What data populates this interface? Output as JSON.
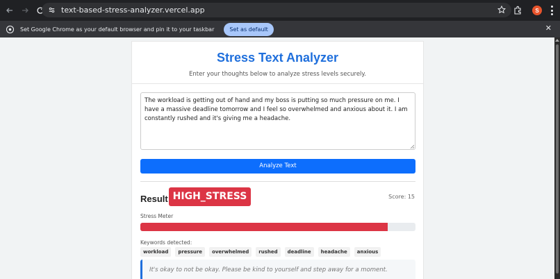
{
  "browser": {
    "url": "text-based-stress-analyzer.vercel.app",
    "avatar_initial": "S"
  },
  "infobar": {
    "message": "Set Google Chrome as your default browser and pin it to your taskbar",
    "button_label": "Set as default",
    "close_glyph": "✕"
  },
  "app": {
    "title": "Stress Text Analyzer",
    "subtitle": "Enter your thoughts below to analyze stress levels securely.",
    "input_text": "The workload is getting out of hand and my boss is putting so much pressure on me. I have a massive deadline tomorrow and I feel so overwhelmed and anxious about it. I am constantly rushed and it's giving me a headache.",
    "analyze_label": "Analyze Text"
  },
  "result": {
    "label": "Result:",
    "status": "HIGH_STRESS",
    "score": "Score: 15",
    "meter_label": "Stress Meter",
    "meter_fraction": 0.9,
    "status_color": "#dc3545",
    "keywords_label": "Keywords detected:",
    "keywords": [
      "workload",
      "pressure",
      "overwhelmed",
      "rushed",
      "deadline",
      "headache",
      "anxious"
    ],
    "advice": "It's okay to not be okay. Please be kind to yourself and step away for a moment."
  },
  "colors": {
    "accent": "#1f6fdc",
    "button": "#0d6efd",
    "danger": "#dc3545"
  }
}
